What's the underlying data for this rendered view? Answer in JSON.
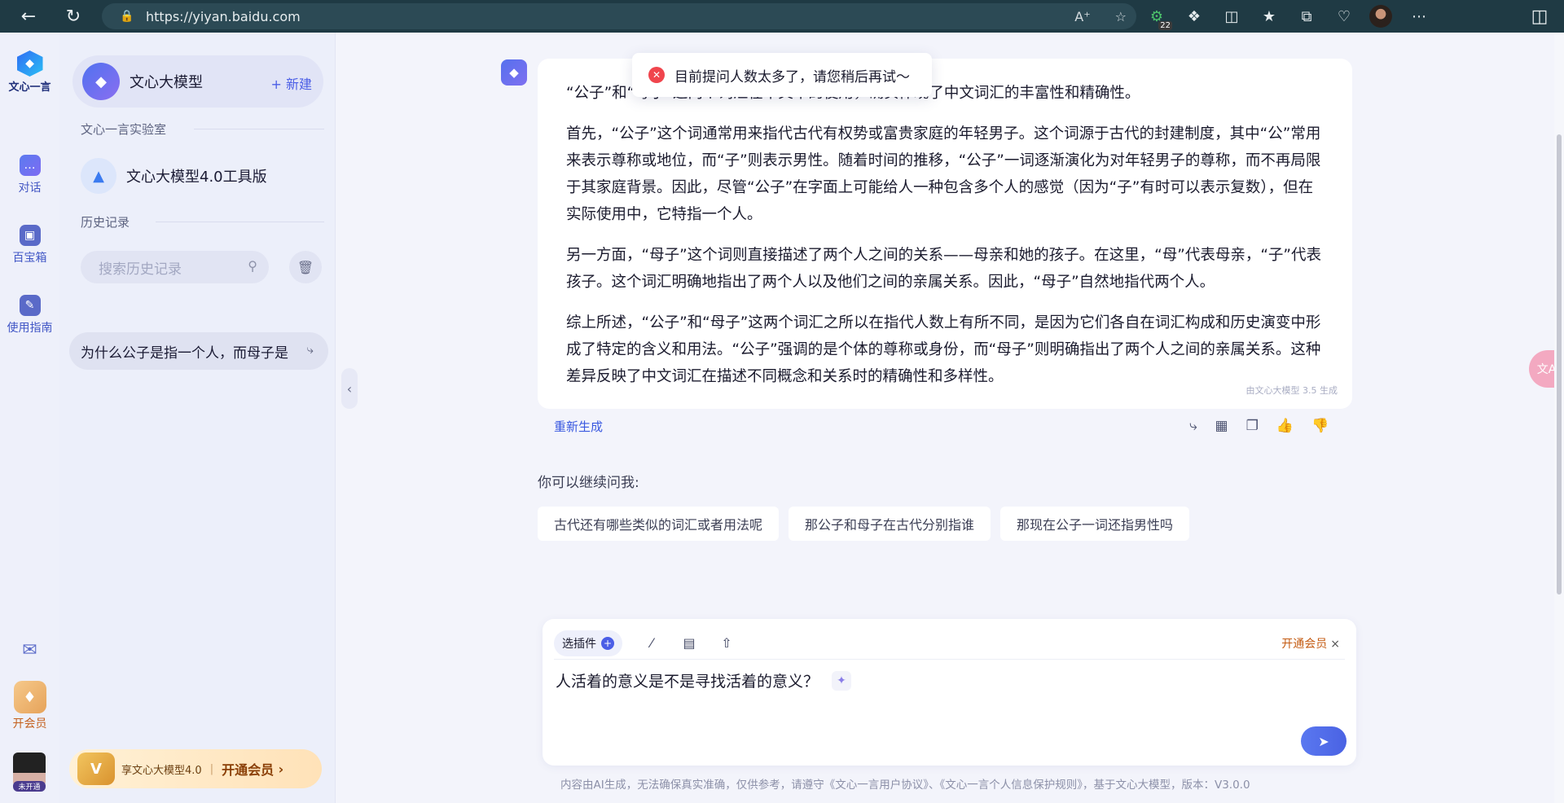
{
  "browser": {
    "url": "https://yiyan.baidu.com",
    "extension_badge": "22"
  },
  "rail": {
    "logo_label": "文心一言",
    "items": [
      {
        "label": "对话",
        "icon": "chat-icon"
      },
      {
        "label": "百宝箱",
        "icon": "treasure-box-icon"
      },
      {
        "label": "使用指南",
        "icon": "guide-icon"
      }
    ],
    "vip_label": "开会员",
    "avatar_tag": "未开通"
  },
  "sidebar": {
    "model_name": "文心大模型",
    "new_label": "+ 新建",
    "lab_section": "文心一言实验室",
    "tool_item": "文心大模型4.0工具版",
    "history_section": "历史记录",
    "search_placeholder": "搜索历史记录",
    "history_items": [
      "为什么公子是指一个人，而母子是"
    ],
    "promo_text": "享文心大模型4.0",
    "promo_cta": "开通会员"
  },
  "toast": {
    "message": "目前提问人数太多了，请您稍后再试～"
  },
  "answer": {
    "paragraphs": [
      "“公子”和“母子”这两个词汇在中文中的使用，确实体现了中文词汇的丰富性和精确性。",
      "首先，“公子”这个词通常用来指代古代有权势或富贵家庭的年轻男子。这个词源于古代的封建制度，其中“公”常用来表示尊称或地位，而“子”则表示男性。随着时间的推移，“公子”一词逐渐演化为对年轻男子的尊称，而不再局限于其家庭背景。因此，尽管“公子”在字面上可能给人一种包含多个人的感觉（因为“子”有时可以表示复数），但在实际使用中，它特指一个人。",
      "另一方面，“母子”这个词则直接描述了两个人之间的关系——母亲和她的孩子。在这里，“母”代表母亲，“子”代表孩子。这个词汇明确地指出了两个人以及他们之间的亲属关系。因此，“母子”自然地指代两个人。",
      "综上所述，“公子”和“母子”这两个词汇之所以在指代人数上有所不同，是因为它们各自在词汇构成和历史演变中形成了特定的含义和用法。“公子”强调的是个体的尊称或身份，而“母子”则明确指出了两个人之间的亲属关系。这种差异反映了中文词汇在描述不同概念和关系时的精确性和多样性。"
    ],
    "generated_by": "由文心大模型 3.5 生成",
    "regenerate_label": "重新生成"
  },
  "suggestions": {
    "title": "你可以继续问我:",
    "items": [
      "古代还有哪些类似的词汇或者用法呢",
      "那公子和母子在古代分别指谁",
      "那现在公子一词还指男性吗"
    ]
  },
  "composer": {
    "plugin_label": "选插件",
    "vip_link": "开通会员",
    "input_value": "人活着的意义是不是寻找活着的意义？"
  },
  "footer": {
    "disclaimer": "内容由AI生成，无法确保真实准确，仅供参考，请遵守《文心一言用户协议》、《文心一言个人信息保护规则》，基于文心大模型，版本：V3.0.0"
  }
}
